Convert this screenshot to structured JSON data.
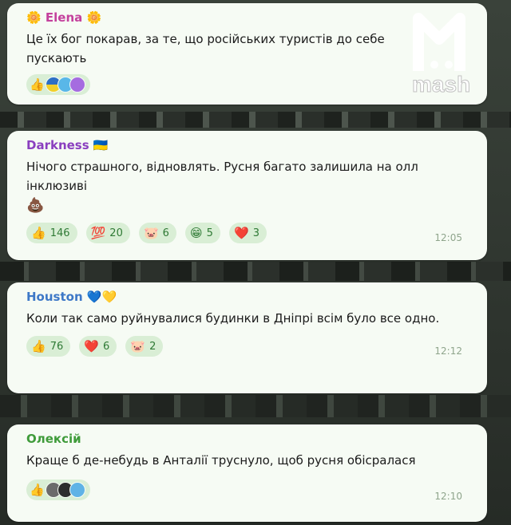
{
  "colors": {
    "accent": "#c4419d",
    "darkness": "#8a3fbf",
    "houston": "#3d78c7",
    "oleksii": "#3f9b3a"
  },
  "watermark": {
    "text": "mash"
  },
  "messages": [
    {
      "sender": "Elena",
      "sender_prefix": "🌼",
      "sender_suffix": "🌼",
      "text": "Це їх бог покарав, за те, що російських туристів до себе пускають",
      "reactions": [
        {
          "emoji": "👍",
          "icon": "thumbs-up-icon"
        }
      ],
      "reactor_avatars": 3
    },
    {
      "sender": "Darkness",
      "sender_suffix": "🇺🇦",
      "text": "Нічого страшного, відновлять. Русня багато залишила на олл інклюзиві",
      "sticker": "💩",
      "reactions": [
        {
          "emoji": "👍",
          "icon": "thumbs-up-icon",
          "count": "146"
        },
        {
          "emoji": "💯",
          "icon": "hundred-icon",
          "count": "20"
        },
        {
          "emoji": "🐷",
          "icon": "pig-icon",
          "count": "6"
        },
        {
          "emoji": "😁",
          "icon": "grin-icon",
          "count": "5"
        },
        {
          "emoji": "❤️",
          "icon": "heart-icon",
          "count": "3"
        }
      ],
      "time": "12:05"
    },
    {
      "sender": "Houston",
      "sender_suffix": "💙💛",
      "text": "Коли так само руйнувалися будинки в Дніпрі всім було все одно.",
      "reactions": [
        {
          "emoji": "👍",
          "icon": "thumbs-up-icon",
          "count": "76"
        },
        {
          "emoji": "❤️",
          "icon": "heart-icon",
          "count": "6"
        },
        {
          "emoji": "🐷",
          "icon": "pig-icon",
          "count": "2"
        }
      ],
      "time": "12:12"
    },
    {
      "sender": "Олексій",
      "text": "Краще б де-небудь в Анталії труснуло, щоб русня обісралася",
      "reactions": [
        {
          "emoji": "👍",
          "icon": "thumbs-up-icon"
        }
      ],
      "reactor_avatars": 3,
      "time": "12:10"
    }
  ]
}
